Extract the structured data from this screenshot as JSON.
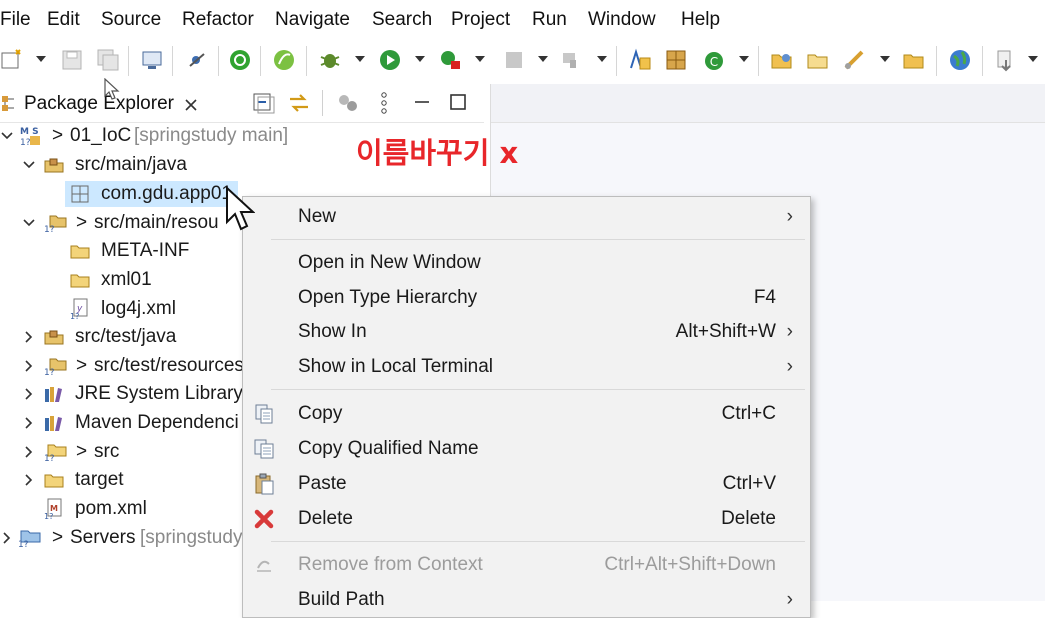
{
  "menubar": {
    "items": [
      "File",
      "Edit",
      "Source",
      "Refactor",
      "Navigate",
      "Search",
      "Project",
      "Run",
      "Window",
      "Help"
    ]
  },
  "explorer": {
    "tab_label": "Package Explorer",
    "tree": [
      {
        "label": "01_IoC",
        "suffix": "[springstudy main]",
        "prefix": ">",
        "expanded": true,
        "icon": "maven-project-icon"
      },
      {
        "label": "src/main/java",
        "expanded": true,
        "icon": "source-folder-icon"
      },
      {
        "label": "com.gdu.app01",
        "selected": true,
        "icon": "package-icon"
      },
      {
        "label": "src/main/resou",
        "prefix": ">",
        "expanded": true,
        "icon": "resource-folder-icon"
      },
      {
        "label": "META-INF",
        "icon": "folder-icon"
      },
      {
        "label": "xml01",
        "icon": "folder-icon"
      },
      {
        "label": "log4j.xml",
        "icon": "xml-file-icon"
      },
      {
        "label": "src/test/java",
        "expanded": false,
        "icon": "source-folder-icon"
      },
      {
        "label": "src/test/resources",
        "prefix": ">",
        "expanded": false,
        "icon": "resource-folder-icon"
      },
      {
        "label": "JRE System Library",
        "expanded": false,
        "icon": "library-icon"
      },
      {
        "label": "Maven Dependenci",
        "expanded": false,
        "icon": "library-icon"
      },
      {
        "label": "src",
        "prefix": ">",
        "expanded": false,
        "icon": "folder-icon"
      },
      {
        "label": "target",
        "expanded": false,
        "icon": "folder-icon"
      },
      {
        "label": "pom.xml",
        "icon": "pom-file-icon"
      },
      {
        "label": "Servers",
        "suffix": "[springstudy",
        "prefix": ">",
        "expanded": false,
        "icon": "servers-project-icon"
      }
    ]
  },
  "annotation": "이름바꾸기 x",
  "context_menu": {
    "items": [
      {
        "label": "New",
        "submenu": true
      },
      {
        "label": "Open in New Window"
      },
      {
        "label": "Open Type Hierarchy",
        "shortcut": "F4"
      },
      {
        "label": "Show In",
        "shortcut": "Alt+Shift+W",
        "submenu": true
      },
      {
        "label": "Show in Local Terminal",
        "submenu": true
      },
      {
        "label": "Copy",
        "shortcut": "Ctrl+C",
        "icon": "copy-icon"
      },
      {
        "label": "Copy Qualified Name",
        "icon": "copy-qualified-icon"
      },
      {
        "label": "Paste",
        "shortcut": "Ctrl+V",
        "icon": "paste-icon"
      },
      {
        "label": "Delete",
        "shortcut": "Delete",
        "icon": "delete-icon"
      },
      {
        "label": "Remove from Context",
        "shortcut": "Ctrl+Alt+Shift+Down",
        "disabled": true,
        "icon": "remove-context-icon"
      },
      {
        "label": "Build Path",
        "submenu": true
      }
    ],
    "submenu_glyph": "›"
  },
  "colors": {
    "selection": "#cce8ff",
    "annotation": "#e8262a",
    "menu_bg": "#f2f2f2"
  }
}
